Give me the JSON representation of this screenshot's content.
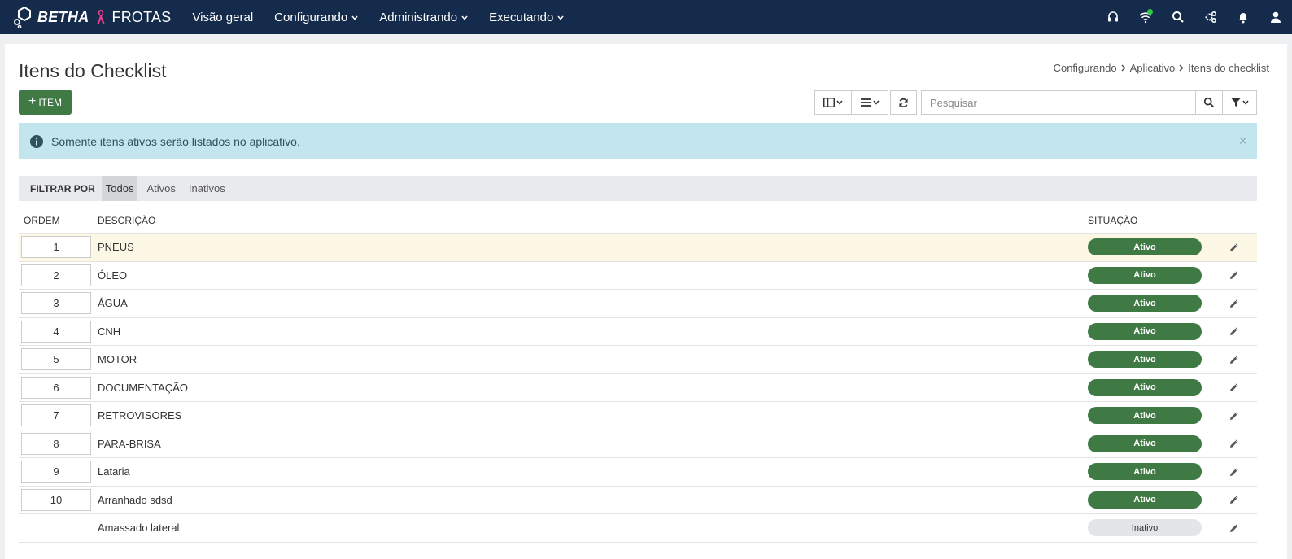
{
  "brand": {
    "name": "BETHA",
    "product": "FROTAS"
  },
  "nav": [
    {
      "label": "Visão geral",
      "dropdown": false
    },
    {
      "label": "Configurando",
      "dropdown": true
    },
    {
      "label": "Administrando",
      "dropdown": true
    },
    {
      "label": "Executando",
      "dropdown": true
    }
  ],
  "topbar_icons": [
    "headset-icon",
    "wifi-icon",
    "search-icon",
    "apps-icon",
    "bell-icon",
    "user-icon"
  ],
  "page": {
    "title": "Itens do Checklist"
  },
  "breadcrumb": [
    "Configurando",
    "Aplicativo",
    "Itens do checklist"
  ],
  "actions": {
    "add_label": "ITEM"
  },
  "search": {
    "placeholder": "Pesquisar",
    "value": ""
  },
  "alert": {
    "text": "Somente itens ativos serão listados no aplicativo.",
    "close": "×"
  },
  "filter": {
    "label": "FILTRAR POR",
    "tabs": [
      "Todos",
      "Ativos",
      "Inativos"
    ],
    "active": "Todos"
  },
  "table": {
    "headers": {
      "ordem": "ORDEM",
      "descricao": "DESCRIÇÃO",
      "situacao": "SITUAÇÃO"
    },
    "rows": [
      {
        "ordem": "1",
        "descricao": "PNEUS",
        "situacao": "Ativo",
        "highlight": true
      },
      {
        "ordem": "2",
        "descricao": "ÓLEO",
        "situacao": "Ativo"
      },
      {
        "ordem": "3",
        "descricao": "ÁGUA",
        "situacao": "Ativo"
      },
      {
        "ordem": "4",
        "descricao": "CNH",
        "situacao": "Ativo"
      },
      {
        "ordem": "5",
        "descricao": "MOTOR",
        "situacao": "Ativo"
      },
      {
        "ordem": "6",
        "descricao": "DOCUMENTAÇÃO",
        "situacao": "Ativo"
      },
      {
        "ordem": "7",
        "descricao": "RETROVISORES",
        "situacao": "Ativo"
      },
      {
        "ordem": "8",
        "descricao": "PARA-BRISA",
        "situacao": "Ativo"
      },
      {
        "ordem": "9",
        "descricao": "Lataria",
        "situacao": "Ativo"
      },
      {
        "ordem": "10",
        "descricao": "Arranhado sdsd",
        "situacao": "Ativo"
      },
      {
        "ordem": "",
        "descricao": "Amassado lateral",
        "situacao": "Inativo"
      }
    ]
  },
  "colors": {
    "navbar": "#152b4b",
    "primary": "#3f7a45",
    "alert_bg": "#c3e5ee",
    "highlight_row": "#fdf8e6",
    "online": "#2ecc40"
  }
}
